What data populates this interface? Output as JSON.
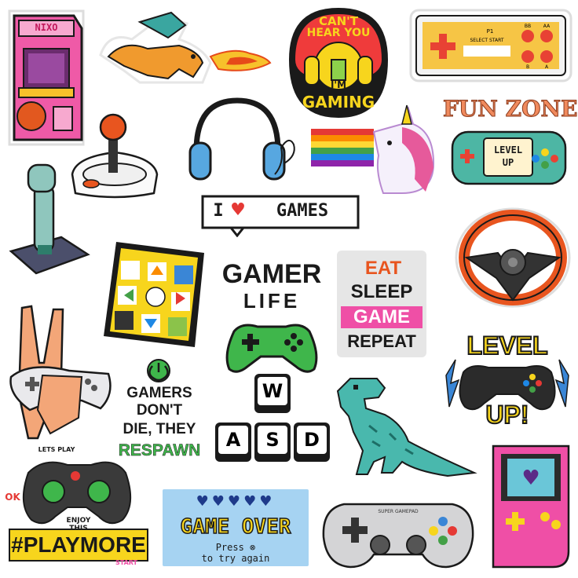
{
  "stickers": {
    "arcade_cabinet": {
      "logo": "NIXO"
    },
    "cant_hear_you": {
      "line1": "CAN'T",
      "line2": "HEAR YOU",
      "line3": "I'M",
      "line4": "GAMING"
    },
    "retro_controller": {
      "p1": "P1",
      "select_start": "SELECT START",
      "bb": "BB",
      "aa": "AA",
      "b": "B",
      "a": "A"
    },
    "fun_zone": {
      "title": "FUN ZONE",
      "screen_line1": "LEVEL",
      "screen_line2": "UP"
    },
    "i_love_games": {
      "i": "I",
      "heart": "♥",
      "games": "GAMES"
    },
    "gamer_life": {
      "line1": "GAMER",
      "line2": "LIFE"
    },
    "eat_sleep": {
      "line1": "EAT",
      "line2": "SLEEP",
      "line3": "GAME",
      "line4": "REPEAT"
    },
    "level_up": {
      "line1": "LEVEL",
      "line2": "UP!"
    },
    "gamers_dont_die": {
      "line1": "GAMERS",
      "line2": "DON'T",
      "line3": "DIE, THEY",
      "line4": "RESPAWN"
    },
    "wasd": {
      "keys": [
        "W",
        "A",
        "S",
        "D"
      ]
    },
    "playmore": {
      "top": "LETS PLAY",
      "side": "OK",
      "enjoy1": "ENJOY",
      "enjoy2": "THIS",
      "main": "#PLAYMORE",
      "start": "START"
    },
    "game_over": {
      "hearts": "♥♥♥♥♥",
      "title": "GAME OVER",
      "press": "Press ⊗",
      "retry": "to try again"
    },
    "super_gamepad": {
      "label": "SUPER GAMEPAD"
    },
    "handheld": {
      "heart": "♥"
    }
  },
  "colors": {
    "outline": "#1a1a1a",
    "pink": "#ef4fa6",
    "yellow": "#f7d51d",
    "green": "#3fb64b",
    "orange": "#f08a1c",
    "red": "#e63b2e",
    "blue": "#3a86d6",
    "teal": "#3fb8a8"
  }
}
